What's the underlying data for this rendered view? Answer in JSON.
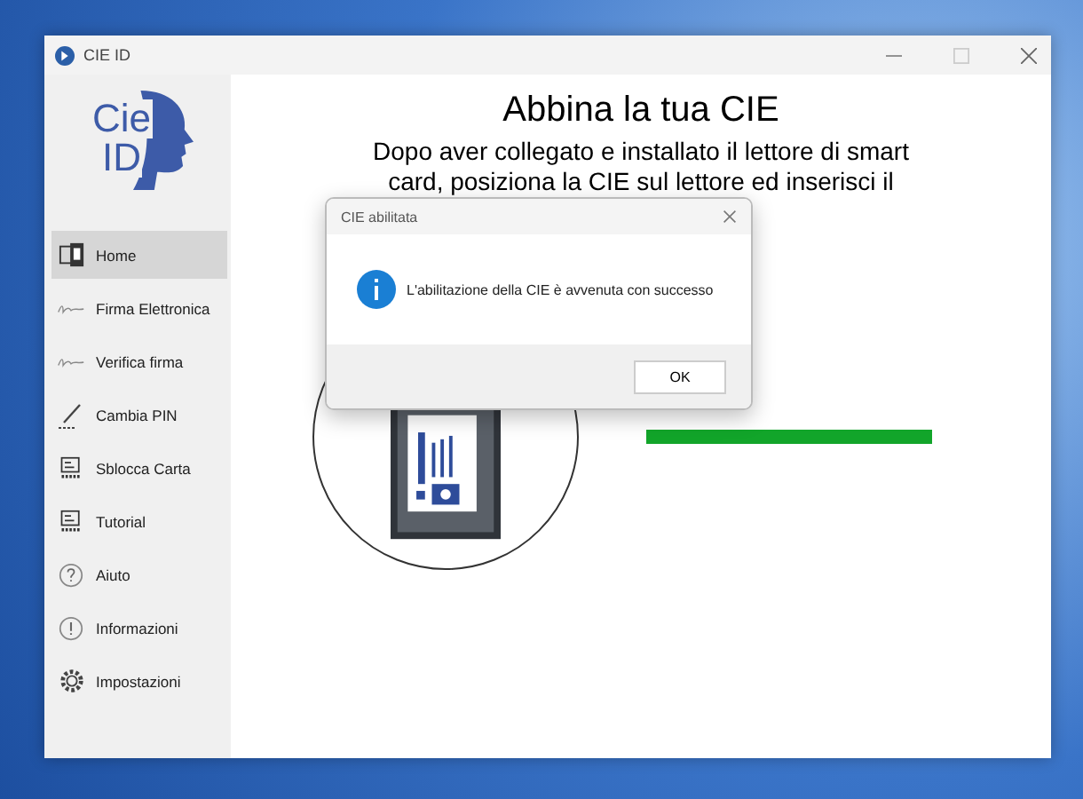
{
  "window": {
    "title": "CIE ID"
  },
  "logo": {
    "lines": [
      "Cie",
      "ID"
    ]
  },
  "sidebar": {
    "items": [
      {
        "label": "Home",
        "kind": "reader",
        "selected": true
      },
      {
        "label": "Firma Elettronica",
        "kind": "signature",
        "selected": false
      },
      {
        "label": "Verifica firma",
        "kind": "signature",
        "selected": false
      },
      {
        "label": "Cambia PIN",
        "kind": "pen",
        "selected": false
      },
      {
        "label": "Sblocca Carta",
        "kind": "keypad",
        "selected": false
      },
      {
        "label": "Tutorial",
        "kind": "keypad",
        "selected": false
      },
      {
        "label": "Aiuto",
        "kind": "question",
        "selected": false
      },
      {
        "label": "Informazioni",
        "kind": "exclamation",
        "selected": false
      },
      {
        "label": "Impostazioni",
        "kind": "gear",
        "selected": false
      }
    ]
  },
  "main": {
    "title": "Abbina la tua CIE",
    "instructions": "Dopo aver collegato e installato il lettore di smart card, posiziona la CIE sul lettore ed inserisci il",
    "progress": {
      "level": 1
    }
  },
  "dialog": {
    "title": "CIE abilitata",
    "message": "L'abilitazione della CIE è avvenuta con successo",
    "button": "OK"
  }
}
